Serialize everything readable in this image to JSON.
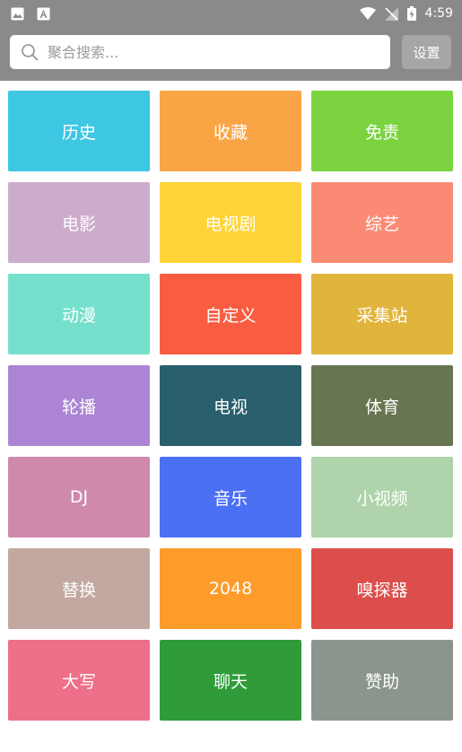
{
  "status_bar": {
    "time": "4:59",
    "left_icons": [
      "image-icon",
      "notification-a-icon"
    ],
    "right_icons": [
      "wifi-icon",
      "no-signal-icon",
      "battery-charging-icon"
    ]
  },
  "search": {
    "placeholder": "聚合搜索...",
    "value": ""
  },
  "header": {
    "settings_label": "设置"
  },
  "tiles": [
    {
      "label": "历史",
      "color": "#3ec7e3"
    },
    {
      "label": "收藏",
      "color": "#f9a545"
    },
    {
      "label": "免责",
      "color": "#7bd43f"
    },
    {
      "label": "电影",
      "color": "#ccaccc"
    },
    {
      "label": "电视剧",
      "color": "#fdd337"
    },
    {
      "label": "综艺",
      "color": "#fa8a73"
    },
    {
      "label": "动漫",
      "color": "#76e0cc"
    },
    {
      "label": "自定义",
      "color": "#f95d41"
    },
    {
      "label": "采集站",
      "color": "#e1b53b"
    },
    {
      "label": "轮播",
      "color": "#ab85d4"
    },
    {
      "label": "电视",
      "color": "#2a5f6d"
    },
    {
      "label": "体育",
      "color": "#677651"
    },
    {
      "label": "DJ",
      "color": "#ce89ab"
    },
    {
      "label": "音乐",
      "color": "#4c70f3"
    },
    {
      "label": "小视频",
      "color": "#afd3aa"
    },
    {
      "label": "替换",
      "color": "#c2a8a1"
    },
    {
      "label": "2048",
      "color": "#fd9b2b"
    },
    {
      "label": "嗅探器",
      "color": "#dc4e4b"
    },
    {
      "label": "大写",
      "color": "#ed6f89"
    },
    {
      "label": "聊天",
      "color": "#2f9c39"
    },
    {
      "label": "赞助",
      "color": "#8a968d"
    }
  ]
}
